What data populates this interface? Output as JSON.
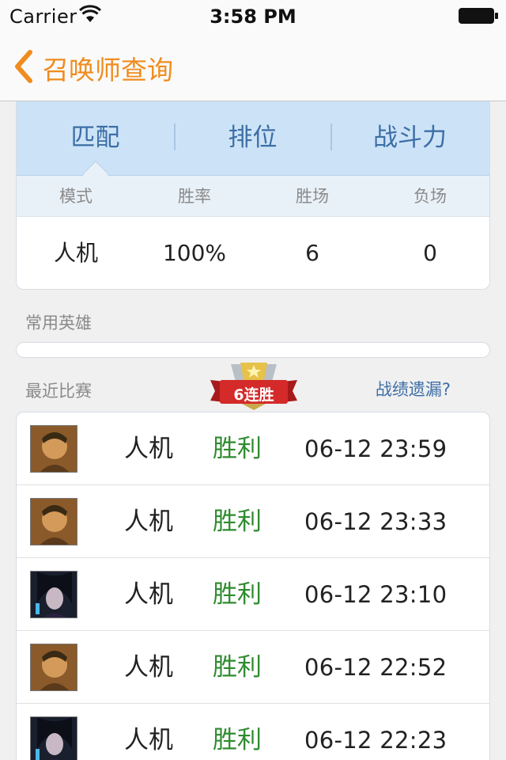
{
  "status_bar": {
    "carrier": "Carrier",
    "time": "3:58 PM"
  },
  "nav": {
    "title": "召唤师查询"
  },
  "tabs": [
    {
      "label": "匹配",
      "selected": true
    },
    {
      "label": "排位",
      "selected": false
    },
    {
      "label": "战斗力",
      "selected": false
    }
  ],
  "stats": {
    "headers": [
      "模式",
      "胜率",
      "胜场",
      "负场"
    ],
    "row": [
      "人机",
      "100%",
      "6",
      "0"
    ]
  },
  "heroes": {
    "label": "常用英雄"
  },
  "recent": {
    "label": "最近比赛",
    "streak_badge": "6连胜",
    "missing_link": "战绩遗漏?",
    "matches": [
      {
        "avatar": "hero-a",
        "mode": "人机",
        "result": "胜利",
        "time": "06-12 23:59"
      },
      {
        "avatar": "hero-a",
        "mode": "人机",
        "result": "胜利",
        "time": "06-12 23:33"
      },
      {
        "avatar": "hero-b",
        "mode": "人机",
        "result": "胜利",
        "time": "06-12 23:10"
      },
      {
        "avatar": "hero-a",
        "mode": "人机",
        "result": "胜利",
        "time": "06-12 22:52"
      },
      {
        "avatar": "hero-b",
        "mode": "人机",
        "result": "胜利",
        "time": "06-12 22:23"
      }
    ]
  },
  "colors": {
    "accent": "#f08c1e",
    "tab_bg": "#cce3f7",
    "tab_text": "#3d6ea6",
    "win": "#2e8b2e"
  }
}
